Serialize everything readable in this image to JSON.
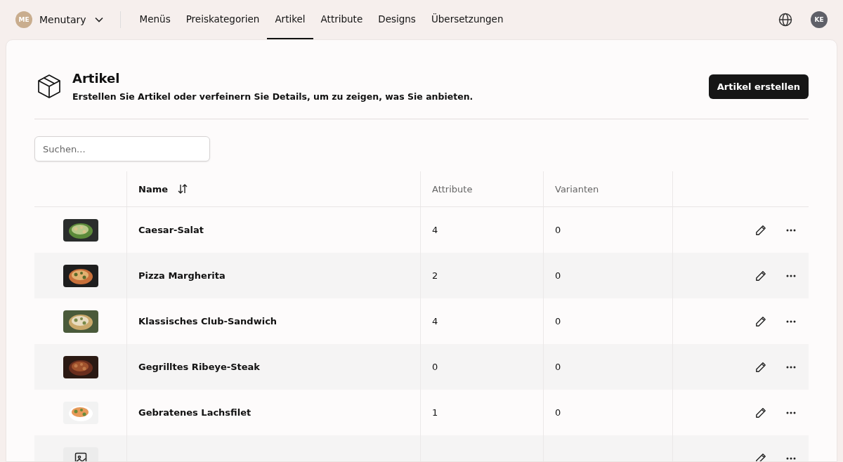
{
  "nav": {
    "account": {
      "initials": "ME",
      "name": "Menutary"
    },
    "tabs": [
      {
        "label": "Menüs",
        "selected": false
      },
      {
        "label": "Preiskategorien",
        "selected": false
      },
      {
        "label": "Artikel",
        "selected": true
      },
      {
        "label": "Attribute",
        "selected": false
      },
      {
        "label": "Designs",
        "selected": false
      },
      {
        "label": "Übersetzungen",
        "selected": false
      }
    ],
    "user_initials": "KE"
  },
  "header": {
    "title": "Artikel",
    "subtitle": "Erstellen Sie Artikel oder verfeinern Sie Details, um zu zeigen, was Sie anbieten.",
    "button": "Artikel erstellen"
  },
  "search": {
    "placeholder": "Suchen..."
  },
  "table": {
    "columns": [
      "Name",
      "Attribute",
      "Varianten"
    ],
    "rows": [
      {
        "name": "Caesar-Salat",
        "attributes": "4",
        "variants": "0"
      },
      {
        "name": "Pizza Margherita",
        "attributes": "2",
        "variants": "0"
      },
      {
        "name": "Klassisches Club-Sandwich",
        "attributes": "4",
        "variants": "0"
      },
      {
        "name": "Gegrilltes Ribeye-Steak",
        "attributes": "0",
        "variants": "0"
      },
      {
        "name": "Gebratenes Lachsfilet",
        "attributes": "1",
        "variants": "0"
      },
      {
        "image": {
          "kind": "placeholder"
        }
      }
    ]
  }
}
